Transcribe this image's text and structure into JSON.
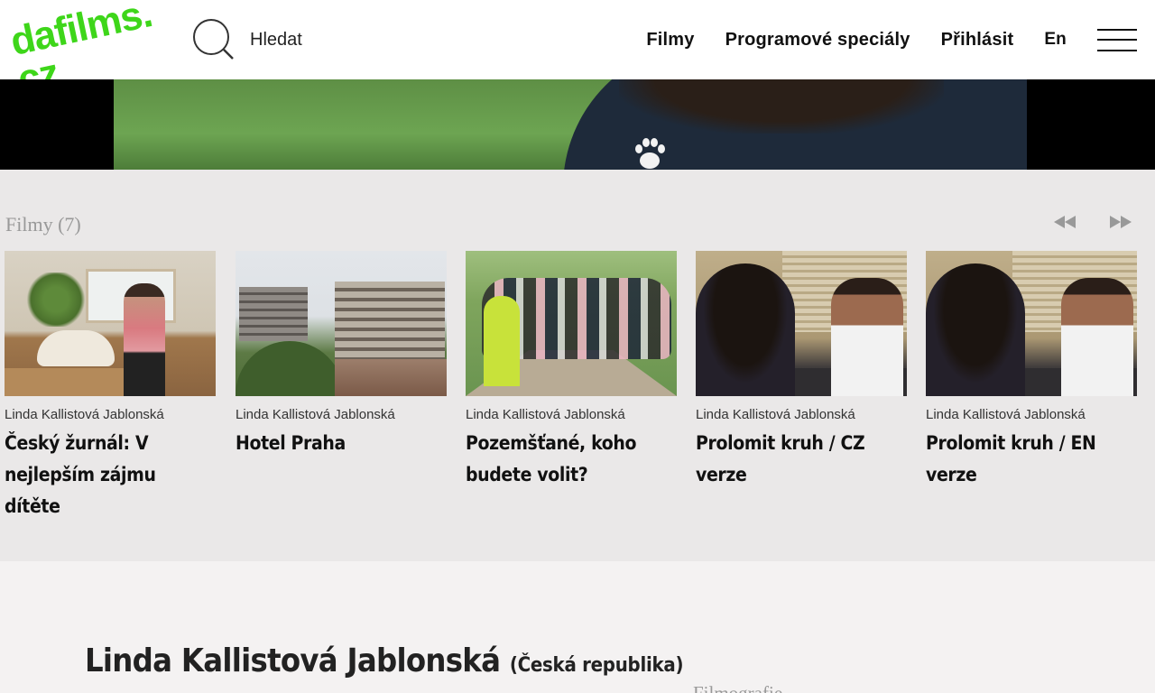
{
  "header": {
    "logo_line1": "dafilms.",
    "logo_line2": "cz",
    "search_label": "Hledat",
    "nav": [
      "Filmy",
      "Programové speciály",
      "Přihlásit"
    ],
    "lang": "En"
  },
  "films_section": {
    "title": "Filmy (7)",
    "cards": [
      {
        "author": "Linda Kallistová Jablonská",
        "title": "Český žurnál: V nejlepším zájmu dítěte"
      },
      {
        "author": "Linda Kallistová Jablonská",
        "title": "Hotel Praha"
      },
      {
        "author": "Linda Kallistová Jablonská",
        "title": "Pozemšťané, koho budete volit?"
      },
      {
        "author": "Linda Kallistová Jablonská",
        "title": "Prolomit kruh / CZ verze"
      },
      {
        "author": "Linda Kallistová Jablonská",
        "title": "Prolomit kruh / EN verze"
      }
    ]
  },
  "profile": {
    "name": "Linda Kallistová Jablonská",
    "country": "(Česká republika)",
    "filmography_label": "Filmografie"
  },
  "colors": {
    "brand_green": "#3ed61a",
    "strip_bg": "#eae8e8",
    "page_bg": "#f4f2f2"
  }
}
